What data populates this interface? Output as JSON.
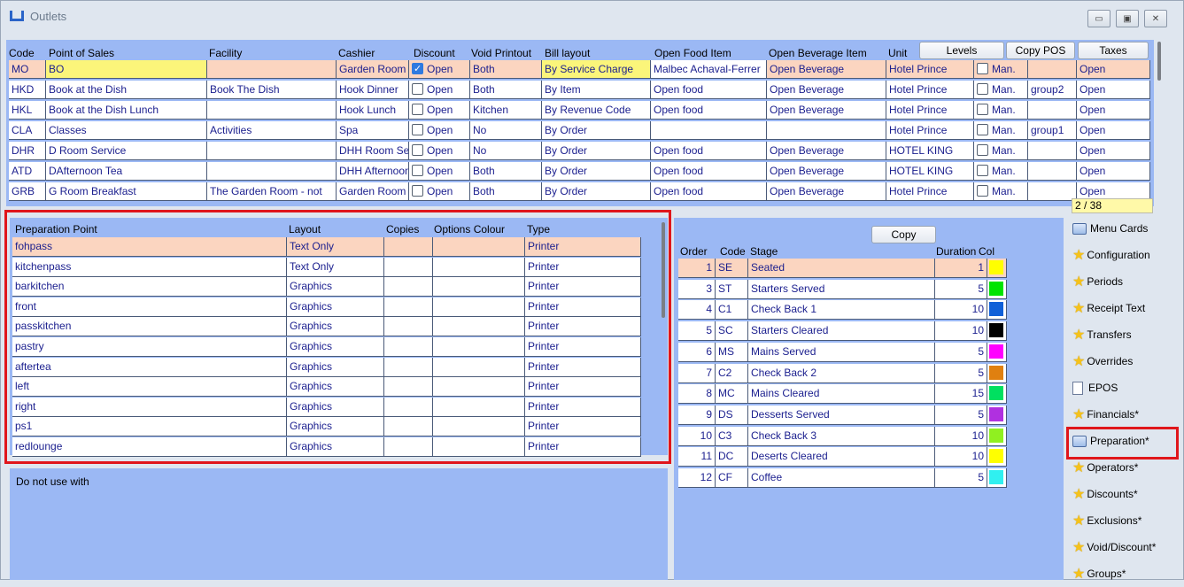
{
  "window": {
    "title": "Outlets"
  },
  "outlets": {
    "headers": [
      "Code",
      "Point of Sales",
      "Facility",
      "Cashier",
      "Discount",
      "Void Printout",
      "Bill layout",
      "Open Food Item",
      "Open Beverage Item",
      "Unit"
    ],
    "buttons": {
      "levels": "Levels",
      "copy_pos": "Copy POS",
      "taxes": "Taxes"
    },
    "rows": [
      [
        "MO",
        "BO",
        "",
        "Garden Room",
        "Open",
        "Both",
        "By Service Charge",
        "Malbec Achaval-Ferrer",
        "Open Beverage",
        "Hotel Prince",
        "Man.",
        "",
        "Open"
      ],
      [
        "HKD",
        "Book at the Dish",
        "Book The Dish",
        "Hook Dinner",
        "Open",
        "Both",
        "By Item",
        "Open food",
        "Open Beverage",
        "Hotel Prince",
        "Man.",
        "group2",
        "Open"
      ],
      [
        "HKL",
        "Book at the Dish Lunch",
        "",
        "Hook Lunch",
        "Open",
        "Kitchen",
        "By Revenue Code",
        "Open food",
        "Open Beverage",
        "Hotel Prince",
        "Man.",
        "",
        "Open"
      ],
      [
        "CLA",
        "Classes",
        "Activities",
        "Spa",
        "Open",
        "No",
        "By Order",
        "",
        "",
        "Hotel Prince",
        "Man.",
        "group1",
        "Open"
      ],
      [
        "DHR",
        "D Room Service",
        "",
        "DHH Room Service",
        "Open",
        "No",
        "By Order",
        "Open food",
        "Open Beverage",
        "HOTEL KING",
        "Man.",
        "",
        "Open"
      ],
      [
        "ATD",
        "DAfternoon Tea",
        "",
        "DHH Afternoon Tea",
        "Open",
        "Both",
        "By Order",
        "Open food",
        "Open Beverage",
        "HOTEL KING",
        "Man.",
        "",
        "Open"
      ],
      [
        "GRB",
        "G Room Breakfast",
        "The Garden Room - not",
        "Garden Room",
        "Open",
        "Both",
        "By Order",
        "Open food",
        "Open Beverage",
        "Hotel Prince",
        "Man.",
        "",
        "Open"
      ]
    ],
    "record_counter": "2 / 38"
  },
  "prep": {
    "headers": [
      "Preparation Point",
      "Layout",
      "Copies",
      "Options Colour",
      "Type"
    ],
    "rows": [
      [
        "fohpass",
        "Text Only",
        "",
        "",
        "Printer"
      ],
      [
        "kitchenpass",
        "Text Only",
        "",
        "",
        "Printer"
      ],
      [
        "barkitchen",
        "Graphics",
        "",
        "",
        "Printer"
      ],
      [
        "front",
        "Graphics",
        "",
        "",
        "Printer"
      ],
      [
        "passkitchen",
        "Graphics",
        "",
        "",
        "Printer"
      ],
      [
        "pastry",
        "Graphics",
        "",
        "",
        "Printer"
      ],
      [
        "aftertea",
        "Graphics",
        "",
        "",
        "Printer"
      ],
      [
        "left",
        "Graphics",
        "",
        "",
        "Printer"
      ],
      [
        "right",
        "Graphics",
        "",
        "",
        "Printer"
      ],
      [
        "ps1",
        "Graphics",
        "",
        "",
        "Printer"
      ],
      [
        "redlounge",
        "Graphics",
        "",
        "",
        "Printer"
      ]
    ],
    "note": "Do not use with"
  },
  "stages": {
    "copy_label": "Copy",
    "headers": [
      "Order",
      "Code",
      "Stage",
      "Duration",
      "Col"
    ],
    "rows": [
      [
        "1",
        "SE",
        "Seated",
        "1",
        "#ffff00"
      ],
      [
        "3",
        "ST",
        "Starters Served",
        "5",
        "#00e400"
      ],
      [
        "4",
        "C1",
        "Check Back 1",
        "10",
        "#1060d8"
      ],
      [
        "5",
        "SC",
        "Starters Cleared",
        "10",
        "#000000"
      ],
      [
        "6",
        "MS",
        "Mains Served",
        "5",
        "#ff00ff"
      ],
      [
        "7",
        "C2",
        "Check Back 2",
        "5",
        "#e08010"
      ],
      [
        "8",
        "MC",
        "Mains Cleared",
        "15",
        "#00e060"
      ],
      [
        "9",
        "DS",
        "Desserts Served",
        "5",
        "#b030e0"
      ],
      [
        "10",
        "C3",
        "Check Back 3",
        "10",
        "#90f020"
      ],
      [
        "11",
        "DC",
        "Deserts Cleared",
        "10",
        "#ffff00"
      ],
      [
        "12",
        "CF",
        "Coffee",
        "5",
        "#30f0f0"
      ]
    ]
  },
  "sidebar": {
    "items": [
      {
        "label": "Menu Cards",
        "icon": "menu-card-icon"
      },
      {
        "label": "Configuration",
        "icon": "star-icon"
      },
      {
        "label": "Periods",
        "icon": "star-icon"
      },
      {
        "label": "Receipt Text",
        "icon": "star-icon"
      },
      {
        "label": "Transfers",
        "icon": "star-icon"
      },
      {
        "label": "Overrides",
        "icon": "star-icon"
      },
      {
        "label": "EPOS",
        "icon": "document-icon"
      },
      {
        "label": "Financials*",
        "icon": "star-icon"
      },
      {
        "label": "Preparation*",
        "icon": "menu-card-icon"
      },
      {
        "label": "Operators*",
        "icon": "star-icon"
      },
      {
        "label": "Discounts*",
        "icon": "star-icon"
      },
      {
        "label": "Exclusions*",
        "icon": "star-icon"
      },
      {
        "label": "Void/Discount*",
        "icon": "star-icon"
      },
      {
        "label": "Groups*",
        "icon": "star-icon"
      }
    ]
  }
}
